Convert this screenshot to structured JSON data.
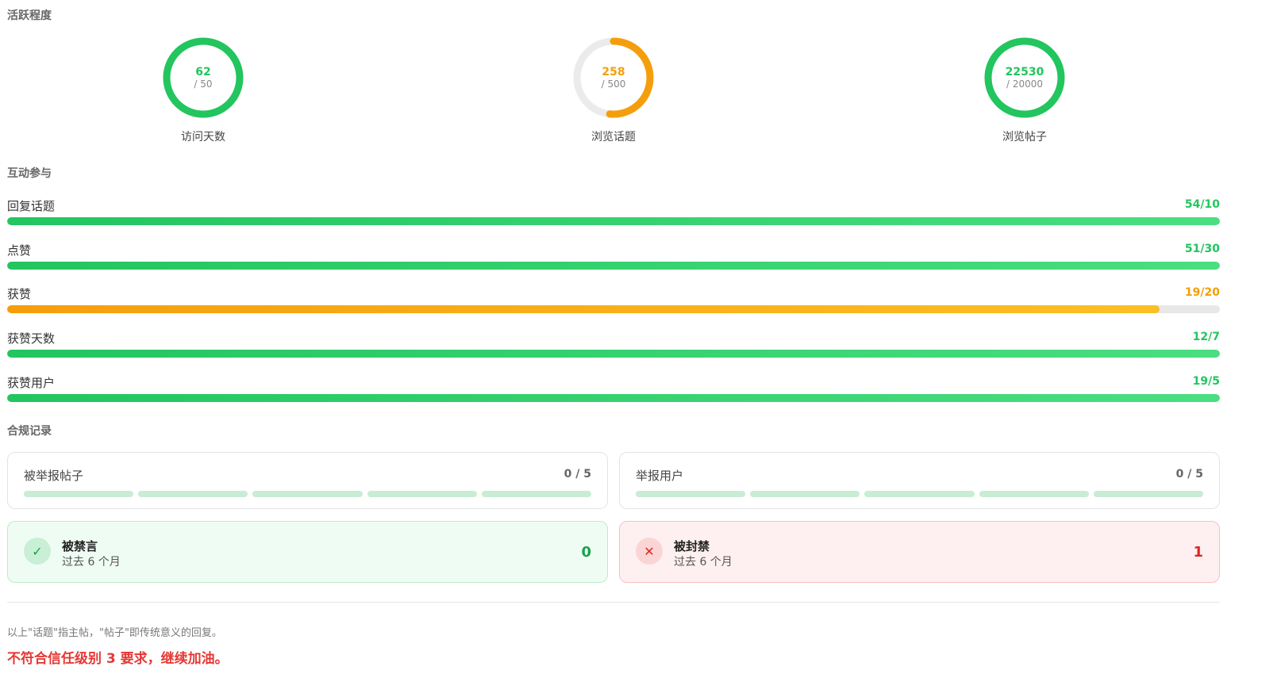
{
  "sections": {
    "activity": "活跃程度",
    "interaction": "互动参与",
    "compliance": "合规记录"
  },
  "activity_rings": [
    {
      "value": "62",
      "target": "/ 50",
      "label": "访问天数",
      "progress": 1.0,
      "color": "#22c55e"
    },
    {
      "value": "258",
      "target": "/ 500",
      "label": "浏览话题",
      "progress": 0.516,
      "color": "#f59e0b"
    },
    {
      "value": "22530",
      "target": "/ 20000",
      "label": "浏览帖子",
      "progress": 1.0,
      "color": "#22c55e"
    }
  ],
  "interaction_rows": [
    {
      "label": "回复话题",
      "value": "54/10",
      "progress": 1.0,
      "status": "green"
    },
    {
      "label": "点赞",
      "value": "51/30",
      "progress": 1.0,
      "status": "green"
    },
    {
      "label": "获赞",
      "value": "19/20",
      "progress": 0.95,
      "status": "orange"
    },
    {
      "label": "获赞天数",
      "value": "12/7",
      "progress": 1.0,
      "status": "green"
    },
    {
      "label": "获赞用户",
      "value": "19/5",
      "progress": 1.0,
      "status": "green"
    }
  ],
  "compliance_cards": [
    {
      "label": "被举报帖子",
      "value": "0 / 5",
      "segments": 5
    },
    {
      "label": "举报用户",
      "value": "0 / 5",
      "segments": 5
    }
  ],
  "status_cards": [
    {
      "title": "被禁言",
      "sub": "过去 6 个月",
      "count": "0",
      "icon": "check-icon",
      "kind": "ok"
    },
    {
      "title": "被封禁",
      "sub": "过去 6 个月",
      "count": "1",
      "icon": "close-icon",
      "kind": "bad"
    }
  ],
  "footer": {
    "note": "以上\"话题\"指主帖，\"帖子\"即传统意义的回复。",
    "verdict": "不符合信任级别 3 要求，继续加油。"
  },
  "colors": {
    "green": "#22c55e",
    "orange": "#f59e0b",
    "red": "#e53935",
    "track": "#ebebeb"
  }
}
